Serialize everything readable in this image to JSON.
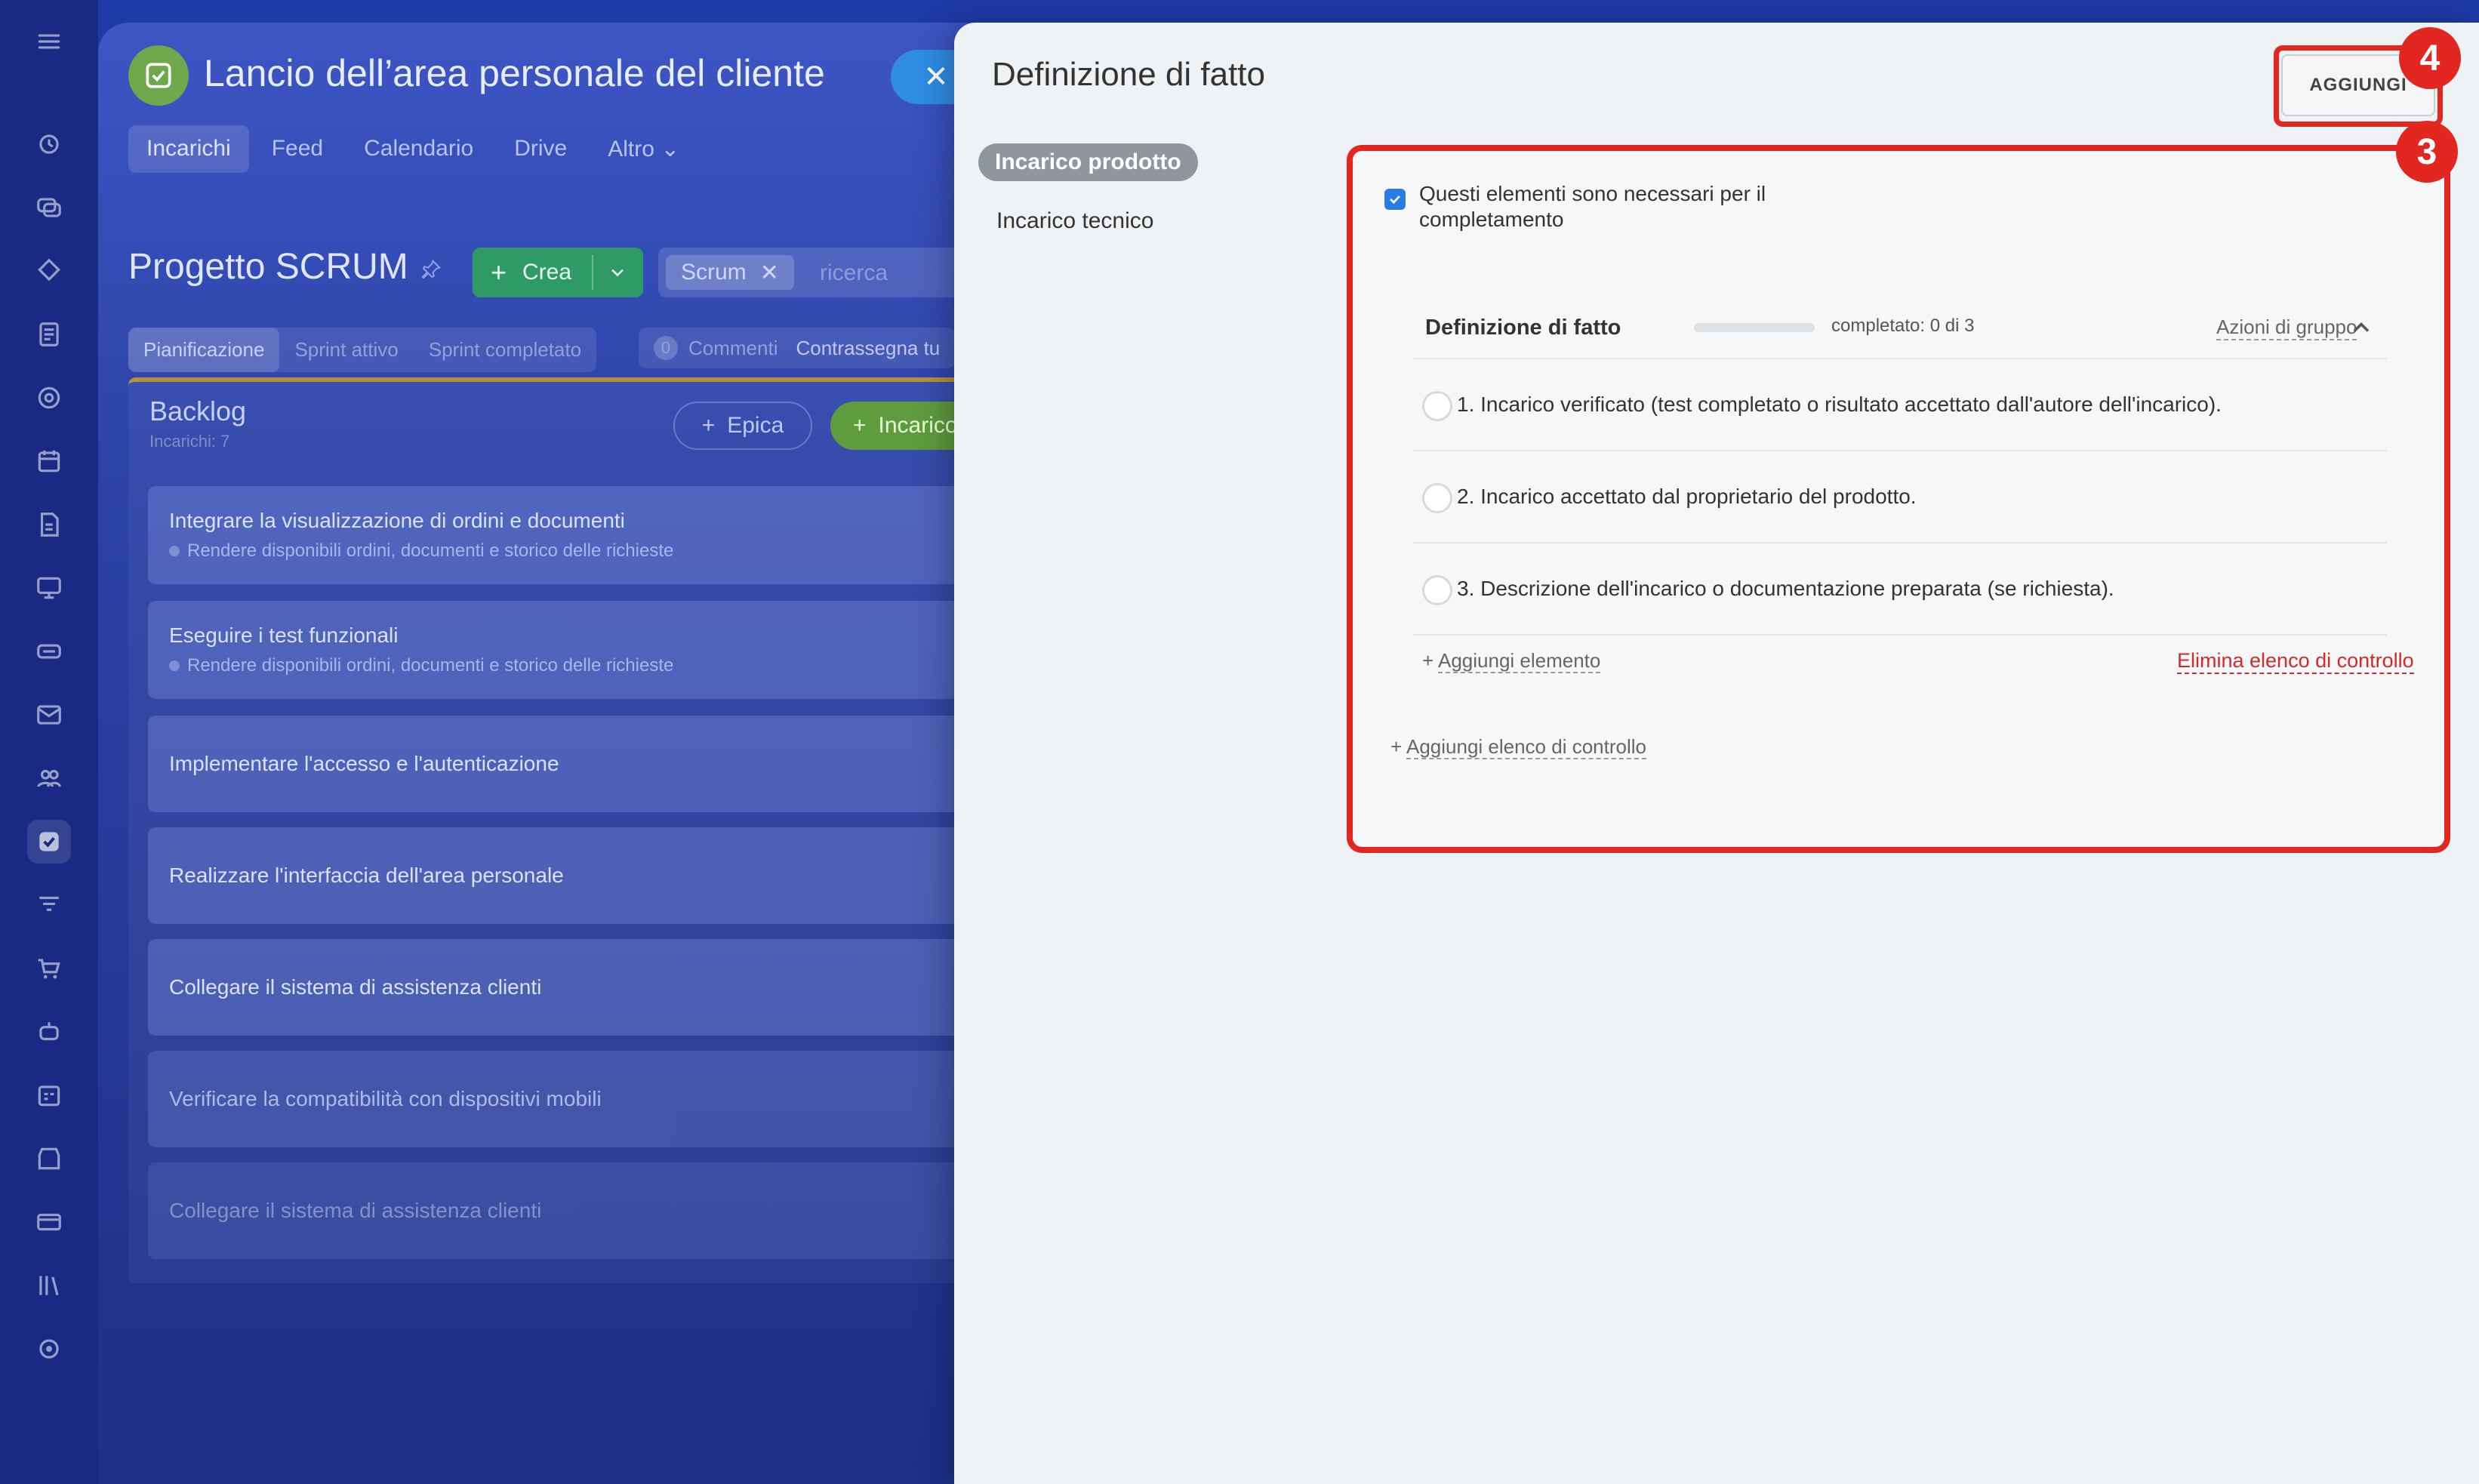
{
  "app": {
    "title": "Lancio dell’area personale del cliente",
    "tabs": [
      "Incarichi",
      "Feed",
      "Calendario",
      "Drive",
      "Altro"
    ],
    "project_title": "Progetto SCRUM",
    "create_label": "Crea",
    "search_tag": "Scrum",
    "search_placeholder": "ricerca",
    "subtabs": [
      "Pianificazione",
      "Sprint attivo",
      "Sprint completato"
    ],
    "comments_count": "0",
    "comments_label": "Commenti",
    "mark_label": "Contrassegna tu",
    "backlog": {
      "title": "Backlog",
      "subtitle": "Incarichi: 7",
      "epic_label": "Epica",
      "task_label": "Incarico",
      "tasks": [
        {
          "title": "Integrare la visualizzazione di ordini e documenti",
          "epic": "Rendere disponibili ordini, documenti e storico delle richieste"
        },
        {
          "title": "Eseguire i test funzionali",
          "epic": "Rendere disponibili ordini, documenti e storico delle richieste"
        },
        {
          "title": "Implementare l'accesso e l'autenticazione"
        },
        {
          "title": "Realizzare l'interfaccia dell'area personale"
        },
        {
          "title": "Collegare il sistema di assistenza clienti"
        },
        {
          "title": "Verificare la compatibilità con dispositivi mobili"
        },
        {
          "title": "Collegare il sistema di assistenza clienti"
        }
      ]
    }
  },
  "panel": {
    "title": "Definizione di fatto",
    "add_button": "AGGIUNGI",
    "badge_add": "4",
    "badge_content": "3",
    "side_tabs": [
      "Incarico prodotto",
      "Incarico tecnico"
    ],
    "required_label": "Questi elementi sono necessari per il completamento",
    "required_checked": true,
    "checklist": {
      "title": "Definizione di fatto",
      "progress_fraction": 0,
      "status": "completato: 0 di 3",
      "group_actions": "Azioni di gruppo",
      "items": [
        "1. Incarico verificato (test completato o risultato accettato dall'autore dell'incarico).",
        "2. Incarico accettato dal proprietario del prodotto.",
        "3. Descrizione dell'incarico o documentazione preparata (se richiesta)."
      ],
      "add_item": "Aggiungi elemento",
      "delete_list": "Elimina elenco di controllo"
    },
    "add_checklist": "Aggiungi elenco di controllo"
  },
  "colors": {
    "accent_red": "#e22620",
    "check_blue": "#2a7be4",
    "delete_red": "#d42a2a"
  }
}
